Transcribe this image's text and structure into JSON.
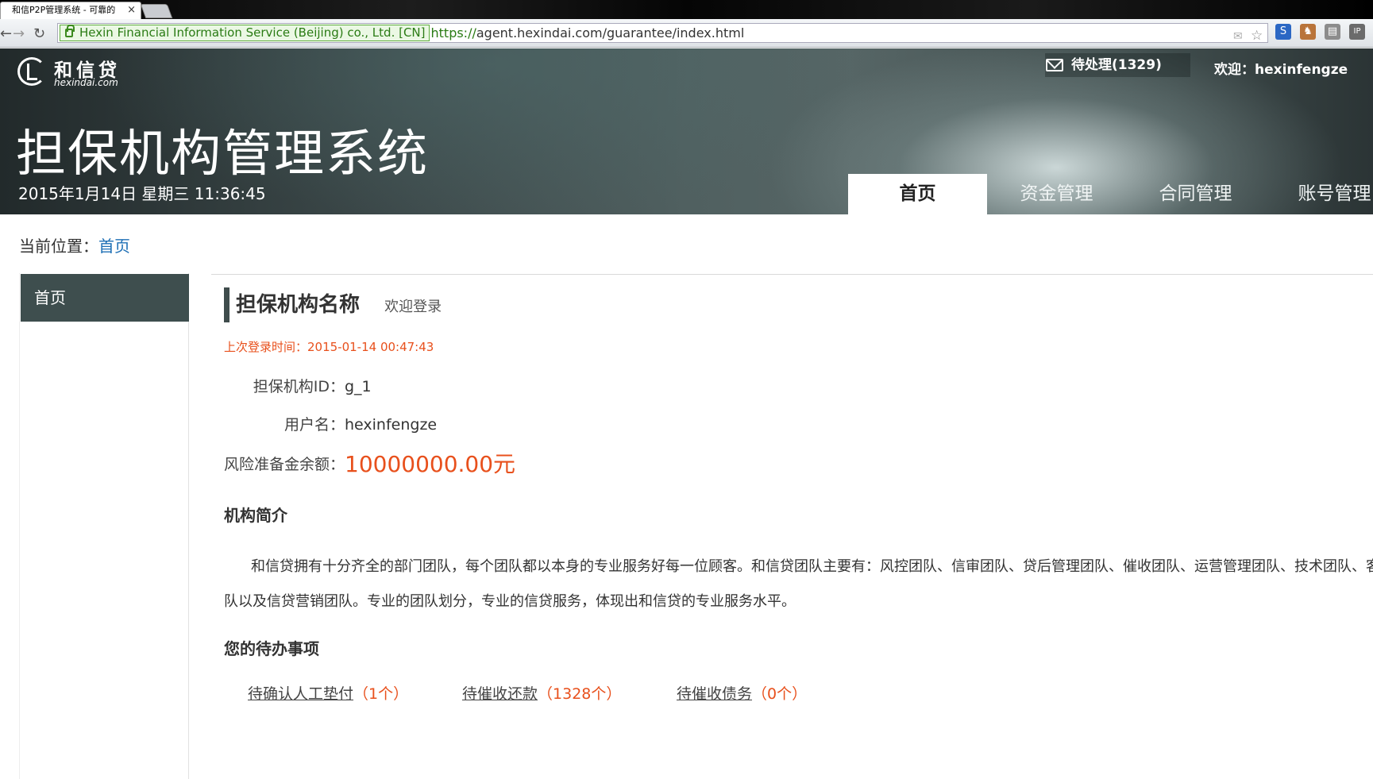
{
  "browser": {
    "tab_title": "和信P2P管理系统 - 可靠的",
    "tab_close": "×",
    "ev_cert": "Hexin Financial Information Service (Beijing) co., Ltd. [CN]",
    "url_scheme": "https://",
    "url_rest": "agent.hexindai.com/guarantee/index.html",
    "icons": [
      "back-icon",
      "forward-icon",
      "reload-icon",
      "lock-icon",
      "bookmark-star-icon",
      "extension-icons"
    ]
  },
  "header": {
    "logo_cn": "和信贷",
    "logo_en": "hexindai.com",
    "system_title": "担保机构管理系统",
    "datetime": "2015年1月14日  星期三  11:36:45",
    "pending": "待处理(1329)",
    "welcome": "欢迎：hexinfengze",
    "nav": [
      {
        "label": "首页",
        "active": true
      },
      {
        "label": "资金管理",
        "active": false
      },
      {
        "label": "合同管理",
        "active": false
      },
      {
        "label": "账号管理",
        "active": false
      }
    ]
  },
  "breadcrumb": {
    "prefix": "当前位置：",
    "current": "首页"
  },
  "sidebar": {
    "items": [
      {
        "label": "首页"
      }
    ]
  },
  "main": {
    "org_name": "担保机构名称",
    "welcome_login": "欢迎登录",
    "last_login": "上次登录时间：2015-01-14 00:47:43",
    "org_id_label": "担保机构ID：",
    "org_id_value": "g_1",
    "username_label": "用户名：",
    "username_value": "hexinfengze",
    "balance_label": "风险准备金余额：",
    "balance_value": "10000000.00元",
    "intro_title": "机构简介",
    "intro_line1": "和信贷拥有十分齐全的部门团队，每个团队都以本身的专业服务好每一位顾客。和信贷团队主要有：风控团队、信审团队、贷后管理团队、催收团队、运营管理团队、技术团队、客",
    "intro_line2": "队以及信贷营销团队。专业的团队划分，专业的信贷服务，体现出和信贷的专业服务水平。",
    "todo_title": "您的待办事项",
    "todos": [
      {
        "label": "待确认人工垫付",
        "count": "（1个）"
      },
      {
        "label": "待催收还款",
        "count": "（1328个）"
      },
      {
        "label": "待催收债务",
        "count": "（0个）"
      }
    ]
  },
  "colors": {
    "accent_orange": "#e8501c",
    "link_blue": "#1d6fb5",
    "header_dark": "#3e4e4e"
  }
}
